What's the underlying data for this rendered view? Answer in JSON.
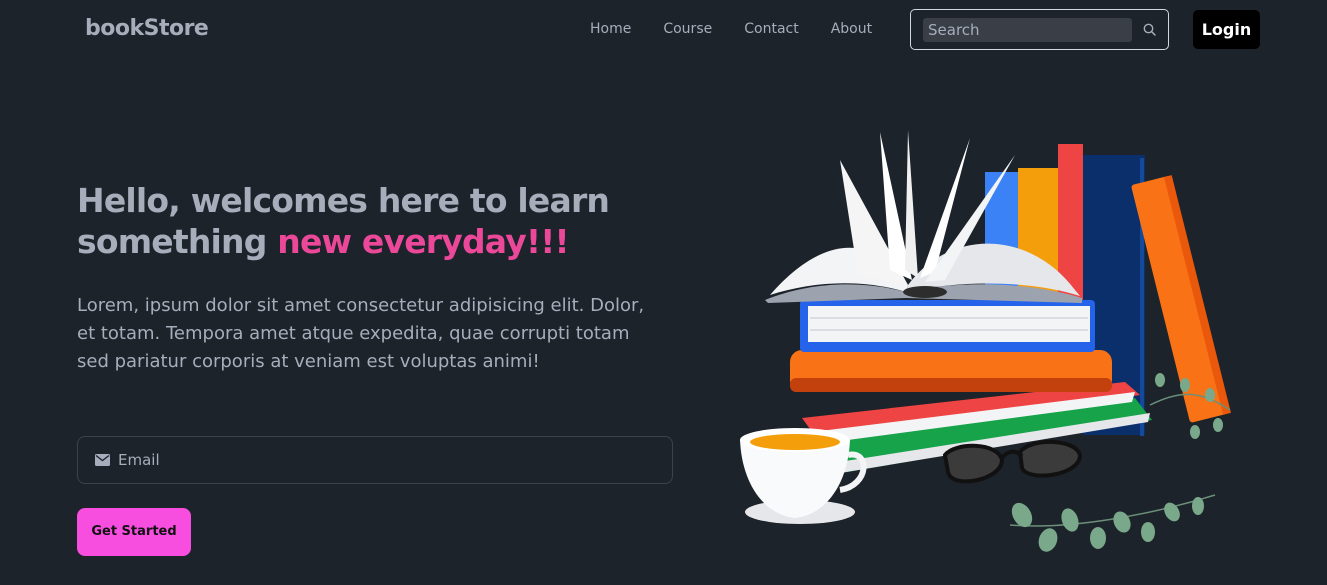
{
  "nav": {
    "brand": "bookStore",
    "links": [
      "Home",
      "Course",
      "Contact",
      "About"
    ],
    "search_placeholder": "Search",
    "login_label": "Login"
  },
  "hero": {
    "title_main": "Hello, welcomes here to learn something ",
    "title_accent": "new everyday!!!",
    "description": "Lorem, ipsum dolor sit amet consectetur adipisicing elit. Dolor, et totam. Tempora amet atque expedita, quae corrupti totam sed pariatur corporis at veniam est voluptas animi!",
    "email_placeholder": "Email",
    "cta_label": "Get Started"
  },
  "icons": {
    "search": "search-icon",
    "email": "mail-icon"
  },
  "colors": {
    "background": "#1d232a",
    "text": "#a6adbb",
    "accent": "#ec4899",
    "cta": "#f74ee0"
  }
}
